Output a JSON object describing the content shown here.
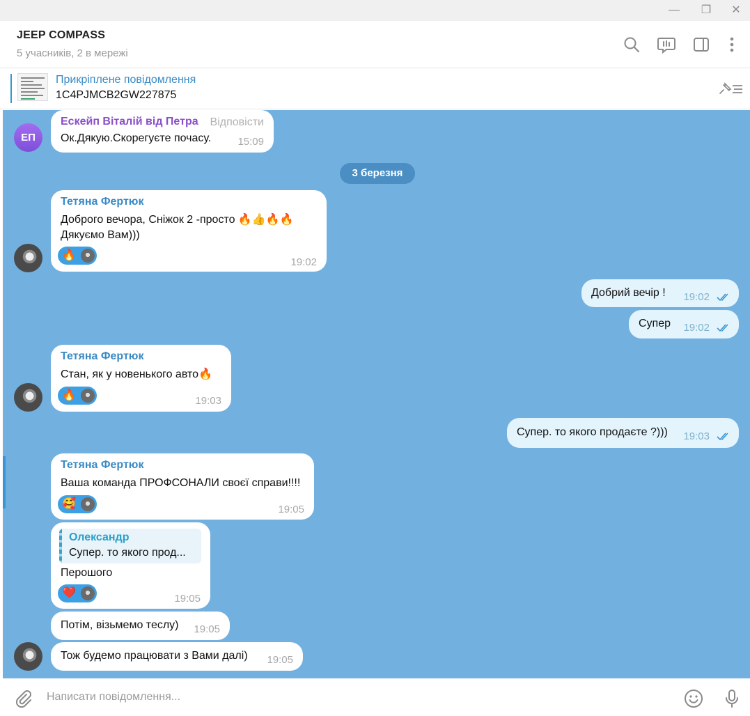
{
  "window": {
    "minimize": "—",
    "restore": "❐",
    "close": "✕"
  },
  "header": {
    "title": "JEEP COMPASS",
    "subtitle": "5 учасників, 2 в мережі"
  },
  "pinned": {
    "title": "Прикріплене повідомлення",
    "text": "1C4PJMCB2GW227875"
  },
  "chat": {
    "date_divider": "3 березня",
    "messages": [
      {
        "sender": "Ескейп Віталій від Петра",
        "sender_color": "#8a4fc8",
        "reply_label": "Відповісти",
        "text": "Ок.Дякую.Скорегуєте почасу.",
        "time": "15:09",
        "avatar": "ЕП"
      },
      {
        "sender": "Тетяна Фертюк",
        "sender_color": "#3a8ac4",
        "line1": "Доброго вечора, Сніжок 2 -просто 🔥👍🔥🔥",
        "line2": "Дякуємо Вам)))",
        "reaction": "🔥",
        "time": "19:02"
      },
      {
        "text": "Добрий вечір !",
        "time": "19:02"
      },
      {
        "text": "Супер",
        "time": "19:02"
      },
      {
        "sender": "Тетяна Фертюк",
        "sender_color": "#3a8ac4",
        "text": "Стан, як у новенького авто🔥",
        "reaction": "🔥",
        "time": "19:03"
      },
      {
        "text": "Супер. то якого продаєте ?)))",
        "time": "19:03"
      },
      {
        "sender": "Тетяна Фертюк",
        "sender_color": "#3a8ac4",
        "text": "Ваша команда ПРОФСОНАЛИ своєї справи!!!!",
        "reaction": "🥰",
        "time": "19:05"
      },
      {
        "quote_name": "Олександр",
        "quote_text": "Супер. то якого прод...",
        "text": "Перошого",
        "reaction": "❤️",
        "time": "19:05"
      },
      {
        "text": "Потім, візьмемо теслу)",
        "time": "19:05"
      },
      {
        "text": "Тож будемо працювати з Вами далі)",
        "time": "19:05"
      }
    ]
  },
  "composer": {
    "placeholder": "Написати повідомлення..."
  },
  "icons": {
    "search": "search-icon",
    "discussion": "discussion-icon",
    "sidebar": "sidebar-toggle-icon",
    "more": "more-vertical-icon",
    "pin_list": "pinned-list-icon",
    "attach": "paperclip-icon",
    "emoji": "emoji-icon",
    "mic": "microphone-icon"
  },
  "colors": {
    "chat_background": "#72b1df",
    "outgoing_bubble": "#e3f4fc",
    "accent": "#3a95d5"
  }
}
